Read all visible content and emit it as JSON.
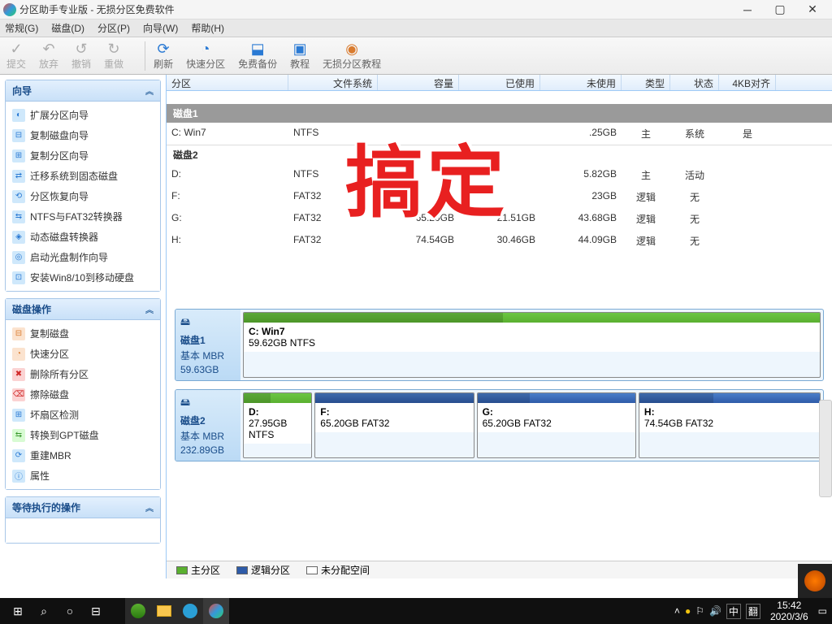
{
  "window": {
    "title": "分区助手专业版 - 无损分区免费软件"
  },
  "menu": {
    "m0": "常规(G)",
    "m1": "磁盘(D)",
    "m2": "分区(P)",
    "m3": "向导(W)",
    "m4": "帮助(H)"
  },
  "toolbar": {
    "commit": "提交",
    "discard": "放弃",
    "undo": "撤销",
    "redo": "重做",
    "refresh": "刷新",
    "quick": "快速分区",
    "backup": "免费备份",
    "tutorial": "教程",
    "lossless": "无损分区教程"
  },
  "sidebar": {
    "wizard": {
      "title": "向导",
      "i0": "扩展分区向导",
      "i1": "复制磁盘向导",
      "i2": "复制分区向导",
      "i3": "迁移系统到固态磁盘",
      "i4": "分区恢复向导",
      "i5": "NTFS与FAT32转换器",
      "i6": "动态磁盘转换器",
      "i7": "启动光盘制作向导",
      "i8": "安装Win8/10到移动硬盘"
    },
    "diskops": {
      "title": "磁盘操作",
      "i0": "复制磁盘",
      "i1": "快速分区",
      "i2": "删除所有分区",
      "i3": "擦除磁盘",
      "i4": "坏扇区检测",
      "i5": "转换到GPT磁盘",
      "i6": "重建MBR",
      "i7": "属性"
    },
    "pending": {
      "title": "等待执行的操作"
    }
  },
  "table": {
    "headers": {
      "partition": "分区",
      "fs": "文件系统",
      "capacity": "容量",
      "used": "已使用",
      "unused": "未使用",
      "type": "类型",
      "status": "状态",
      "align": "4KB对齐"
    },
    "disk1": "磁盘1",
    "disk2": "磁盘2",
    "rows": [
      {
        "name": "C: Win7",
        "fs": "NTFS",
        "cap": "",
        "used": "",
        "free": ".25GB",
        "type": "主",
        "status": "系统",
        "align": "是"
      },
      {
        "name": "D:",
        "fs": "NTFS",
        "cap": "",
        "used": "",
        "free": "5.82GB",
        "type": "主",
        "status": "活动",
        "align": ""
      },
      {
        "name": "F:",
        "fs": "FAT32",
        "cap": "",
        "used": "",
        "free": "23GB",
        "type": "逻辑",
        "status": "无",
        "align": ""
      },
      {
        "name": "G:",
        "fs": "FAT32",
        "cap": "65.20GB",
        "used": "21.51GB",
        "free": "43.68GB",
        "type": "逻辑",
        "status": "无",
        "align": ""
      },
      {
        "name": "H:",
        "fs": "FAT32",
        "cap": "74.54GB",
        "used": "30.46GB",
        "free": "44.09GB",
        "type": "逻辑",
        "status": "无",
        "align": ""
      }
    ]
  },
  "visual": {
    "disk1": {
      "name": "磁盘1",
      "type": "基本 MBR",
      "size": "59.63GB",
      "parts": [
        {
          "label": "C: Win7",
          "sub": "59.62GB NTFS"
        }
      ]
    },
    "disk2": {
      "name": "磁盘2",
      "type": "基本 MBR",
      "size": "232.89GB",
      "parts": [
        {
          "label": "D:",
          "sub": "27.95GB NTFS"
        },
        {
          "label": "F:",
          "sub": "65.20GB FAT32"
        },
        {
          "label": "G:",
          "sub": "65.20GB FAT32"
        },
        {
          "label": "H:",
          "sub": "74.54GB FAT32"
        }
      ]
    }
  },
  "legend": {
    "primary": "主分区",
    "logical": "逻辑分区",
    "unalloc": "未分配空间"
  },
  "overlay": "搞定",
  "taskbar": {
    "ime1": "中",
    "ime2": "翻",
    "time": "15:42",
    "date": "2020/3/6"
  }
}
